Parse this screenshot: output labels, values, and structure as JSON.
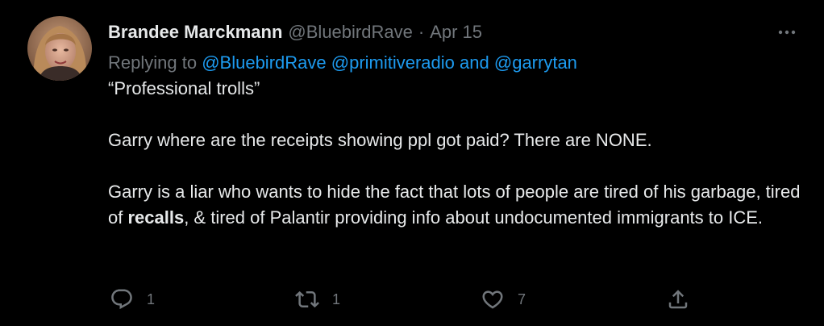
{
  "tweet": {
    "author": {
      "display_name": "Brandee Marckmann",
      "handle": "@BluebirdRave"
    },
    "separator": "·",
    "date": "Apr 15",
    "replying": {
      "prefix": "Replying to",
      "mention_1": "@BluebirdRave",
      "mention_2": "@primitiveradio",
      "conjunction": "and",
      "mention_3": "@garrytan"
    },
    "body": {
      "line_1": "“Professional trolls”",
      "line_2": "Garry where are the receipts showing ppl got paid? There are NONE.",
      "para_3_start": "Garry is a liar who wants to hide the fact that lots of people are tired of his garbage, tired of ",
      "para_3_bold": "recalls",
      "para_3_end": ", & tired of Palantir providing info about undocumented immigrants to ICE."
    },
    "actions": {
      "reply_count": "1",
      "retweet_count": "1",
      "like_count": "7"
    },
    "icons": {
      "reply": "reply-icon",
      "retweet": "retweet-icon",
      "like": "heart-icon",
      "share": "share-icon",
      "more": "more-icon"
    },
    "colors": {
      "background": "#000000",
      "text": "#e7e9ea",
      "secondary": "#71767b",
      "link": "#1d9bf0"
    }
  }
}
